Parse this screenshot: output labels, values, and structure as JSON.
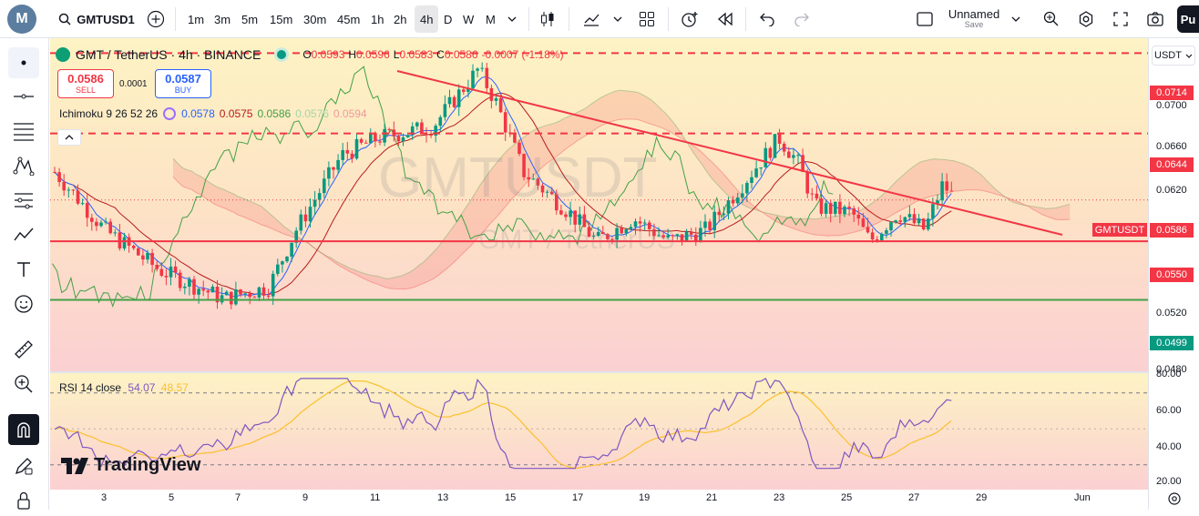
{
  "toolbar": {
    "logo": "M",
    "symbol": "GMTUSD1",
    "timeframes": [
      "1m",
      "3m",
      "5m",
      "15m",
      "30m",
      "45m",
      "1h",
      "2h",
      "4h",
      "D",
      "W",
      "M"
    ],
    "active_timeframe": "4h",
    "layout_name": "Unnamed",
    "layout_sub": "Save",
    "publish": "Pu"
  },
  "legend": {
    "title": "GMT / TetherUS · 4h · BINANCE",
    "o_label": "O",
    "o": "0.0593",
    "h_label": "H",
    "h": "0.0596",
    "l_label": "L",
    "l": "0.0583",
    "c_label": "C",
    "c": "0.0586",
    "chg": "-0.0007 (-1.18%)",
    "sell_price": "0.0586",
    "sell_label": "SELL",
    "spread": "0.0001",
    "buy_price": "0.0587",
    "buy_label": "BUY",
    "ichimoku_label": "Ichimoku 9 26 52 26",
    "ichi_vals": [
      "0.0578",
      "0.0575",
      "0.0586",
      "0.0576",
      "0.0594"
    ],
    "rsi_label": "RSI 14 close",
    "rsi_val": "54.07",
    "rsi_ma": "48.57"
  },
  "currency": "USDT",
  "price_labels": [
    "0.0700",
    "0.0660",
    "0.0620",
    "0.0520",
    "0.0480"
  ],
  "price_boxes": [
    {
      "value": "0.0714",
      "color": "#f23645"
    },
    {
      "value": "0.0644",
      "color": "#f23645"
    },
    {
      "value": "0.0586",
      "color": "#f23645"
    },
    {
      "value": "0.0550",
      "color": "#f23645"
    },
    {
      "value": "0.0499",
      "color": "#089981"
    }
  ],
  "symbol_tag": "GMTUSDT",
  "rsi_labels": [
    "80.00",
    "60.00",
    "40.00",
    "20.00"
  ],
  "date_labels": [
    "3",
    "5",
    "7",
    "9",
    "11",
    "13",
    "15",
    "17",
    "19",
    "21",
    "23",
    "25",
    "27",
    "29",
    "Jun"
  ],
  "watermark": "GMTUSDT",
  "watermark_sub": "GMT / TetherUS",
  "brand": "TradingView",
  "colors": {
    "bull": "#089981",
    "bear": "#f23645",
    "conv": "#2962ff",
    "base": "#b71c1c",
    "lag": "#43a047",
    "rsi": "#7e57c2",
    "rsima": "#fbc02d"
  }
}
